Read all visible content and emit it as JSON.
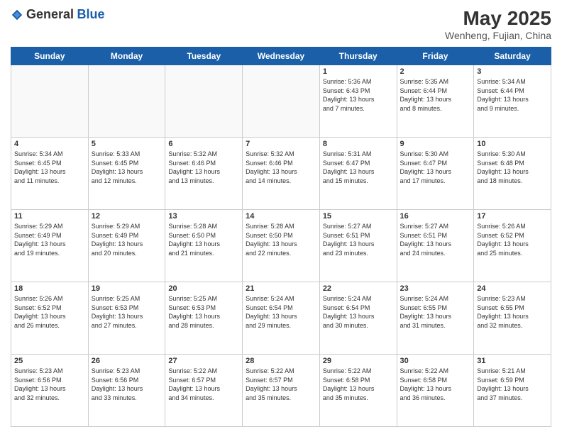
{
  "header": {
    "logo_general": "General",
    "logo_blue": "Blue",
    "month_year": "May 2025",
    "location": "Wenheng, Fujian, China"
  },
  "weekdays": [
    "Sunday",
    "Monday",
    "Tuesday",
    "Wednesday",
    "Thursday",
    "Friday",
    "Saturday"
  ],
  "weeks": [
    [
      {
        "day": "",
        "text": ""
      },
      {
        "day": "",
        "text": ""
      },
      {
        "day": "",
        "text": ""
      },
      {
        "day": "",
        "text": ""
      },
      {
        "day": "1",
        "text": "Sunrise: 5:36 AM\nSunset: 6:43 PM\nDaylight: 13 hours\nand 7 minutes."
      },
      {
        "day": "2",
        "text": "Sunrise: 5:35 AM\nSunset: 6:44 PM\nDaylight: 13 hours\nand 8 minutes."
      },
      {
        "day": "3",
        "text": "Sunrise: 5:34 AM\nSunset: 6:44 PM\nDaylight: 13 hours\nand 9 minutes."
      }
    ],
    [
      {
        "day": "4",
        "text": "Sunrise: 5:34 AM\nSunset: 6:45 PM\nDaylight: 13 hours\nand 11 minutes."
      },
      {
        "day": "5",
        "text": "Sunrise: 5:33 AM\nSunset: 6:45 PM\nDaylight: 13 hours\nand 12 minutes."
      },
      {
        "day": "6",
        "text": "Sunrise: 5:32 AM\nSunset: 6:46 PM\nDaylight: 13 hours\nand 13 minutes."
      },
      {
        "day": "7",
        "text": "Sunrise: 5:32 AM\nSunset: 6:46 PM\nDaylight: 13 hours\nand 14 minutes."
      },
      {
        "day": "8",
        "text": "Sunrise: 5:31 AM\nSunset: 6:47 PM\nDaylight: 13 hours\nand 15 minutes."
      },
      {
        "day": "9",
        "text": "Sunrise: 5:30 AM\nSunset: 6:47 PM\nDaylight: 13 hours\nand 17 minutes."
      },
      {
        "day": "10",
        "text": "Sunrise: 5:30 AM\nSunset: 6:48 PM\nDaylight: 13 hours\nand 18 minutes."
      }
    ],
    [
      {
        "day": "11",
        "text": "Sunrise: 5:29 AM\nSunset: 6:49 PM\nDaylight: 13 hours\nand 19 minutes."
      },
      {
        "day": "12",
        "text": "Sunrise: 5:29 AM\nSunset: 6:49 PM\nDaylight: 13 hours\nand 20 minutes."
      },
      {
        "day": "13",
        "text": "Sunrise: 5:28 AM\nSunset: 6:50 PM\nDaylight: 13 hours\nand 21 minutes."
      },
      {
        "day": "14",
        "text": "Sunrise: 5:28 AM\nSunset: 6:50 PM\nDaylight: 13 hours\nand 22 minutes."
      },
      {
        "day": "15",
        "text": "Sunrise: 5:27 AM\nSunset: 6:51 PM\nDaylight: 13 hours\nand 23 minutes."
      },
      {
        "day": "16",
        "text": "Sunrise: 5:27 AM\nSunset: 6:51 PM\nDaylight: 13 hours\nand 24 minutes."
      },
      {
        "day": "17",
        "text": "Sunrise: 5:26 AM\nSunset: 6:52 PM\nDaylight: 13 hours\nand 25 minutes."
      }
    ],
    [
      {
        "day": "18",
        "text": "Sunrise: 5:26 AM\nSunset: 6:52 PM\nDaylight: 13 hours\nand 26 minutes."
      },
      {
        "day": "19",
        "text": "Sunrise: 5:25 AM\nSunset: 6:53 PM\nDaylight: 13 hours\nand 27 minutes."
      },
      {
        "day": "20",
        "text": "Sunrise: 5:25 AM\nSunset: 6:53 PM\nDaylight: 13 hours\nand 28 minutes."
      },
      {
        "day": "21",
        "text": "Sunrise: 5:24 AM\nSunset: 6:54 PM\nDaylight: 13 hours\nand 29 minutes."
      },
      {
        "day": "22",
        "text": "Sunrise: 5:24 AM\nSunset: 6:54 PM\nDaylight: 13 hours\nand 30 minutes."
      },
      {
        "day": "23",
        "text": "Sunrise: 5:24 AM\nSunset: 6:55 PM\nDaylight: 13 hours\nand 31 minutes."
      },
      {
        "day": "24",
        "text": "Sunrise: 5:23 AM\nSunset: 6:55 PM\nDaylight: 13 hours\nand 32 minutes."
      }
    ],
    [
      {
        "day": "25",
        "text": "Sunrise: 5:23 AM\nSunset: 6:56 PM\nDaylight: 13 hours\nand 32 minutes."
      },
      {
        "day": "26",
        "text": "Sunrise: 5:23 AM\nSunset: 6:56 PM\nDaylight: 13 hours\nand 33 minutes."
      },
      {
        "day": "27",
        "text": "Sunrise: 5:22 AM\nSunset: 6:57 PM\nDaylight: 13 hours\nand 34 minutes."
      },
      {
        "day": "28",
        "text": "Sunrise: 5:22 AM\nSunset: 6:57 PM\nDaylight: 13 hours\nand 35 minutes."
      },
      {
        "day": "29",
        "text": "Sunrise: 5:22 AM\nSunset: 6:58 PM\nDaylight: 13 hours\nand 35 minutes."
      },
      {
        "day": "30",
        "text": "Sunrise: 5:22 AM\nSunset: 6:58 PM\nDaylight: 13 hours\nand 36 minutes."
      },
      {
        "day": "31",
        "text": "Sunrise: 5:21 AM\nSunset: 6:59 PM\nDaylight: 13 hours\nand 37 minutes."
      }
    ]
  ]
}
